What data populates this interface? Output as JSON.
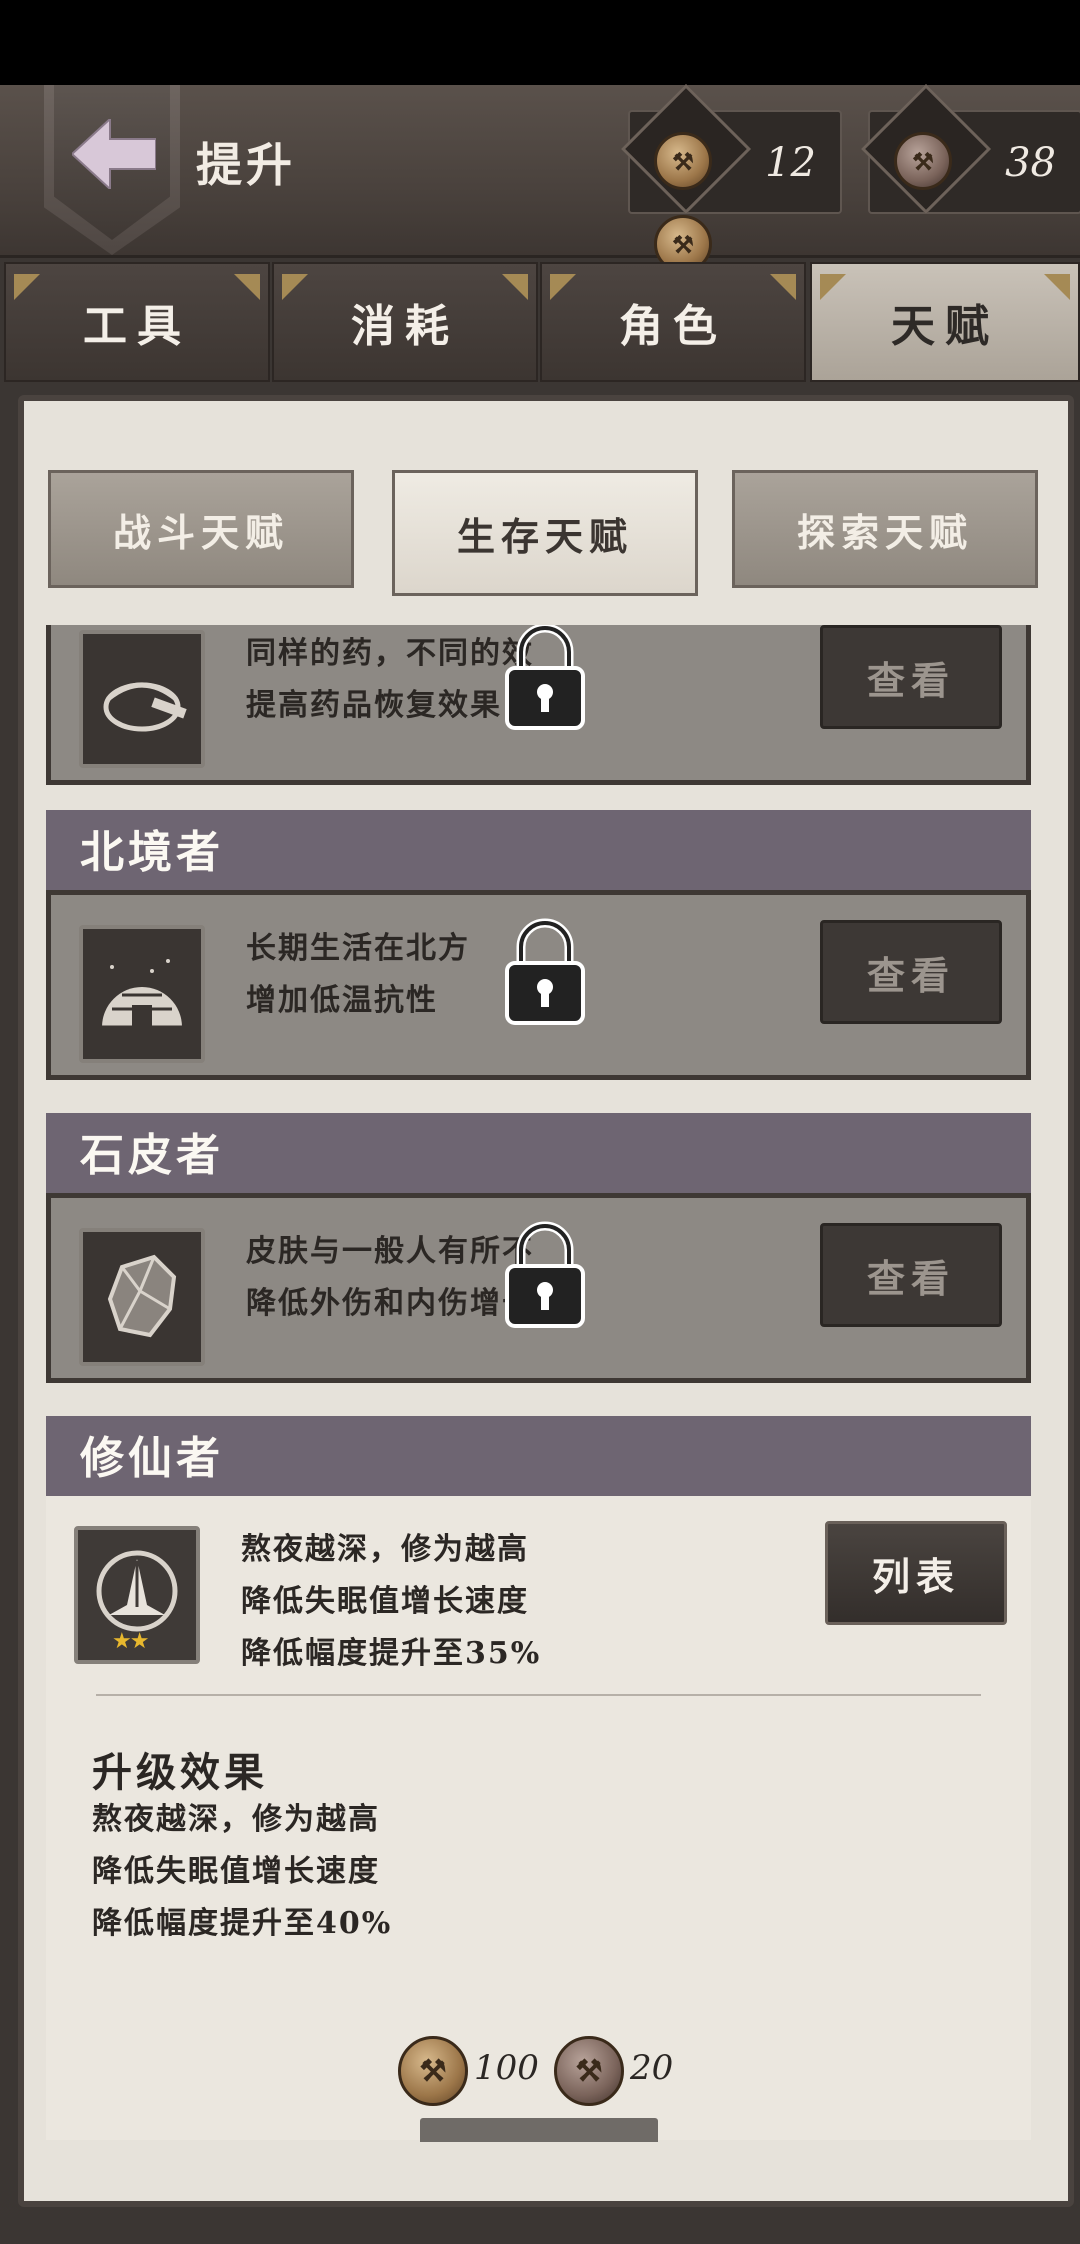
{
  "header": {
    "title": "提升",
    "currency": [
      {
        "icon": "axe-coin-icon",
        "value": "12"
      },
      {
        "icon": "axe-coin-dark-icon",
        "value": "38"
      }
    ]
  },
  "category_tabs": [
    {
      "label": "工具",
      "active": false
    },
    {
      "label": "消耗",
      "active": false
    },
    {
      "label": "角色",
      "active": false
    },
    {
      "label": "天赋",
      "active": true
    }
  ],
  "sub_tabs": [
    {
      "label": "战斗天赋",
      "active": false
    },
    {
      "label": "生存天赋",
      "active": true
    },
    {
      "label": "探索天赋",
      "active": false
    }
  ],
  "talents": [
    {
      "name": "",
      "icon": "medicine-bowl-icon",
      "desc": "同样的药，不同的效\n提高药品恢复效果",
      "locked": true,
      "button": "查看"
    },
    {
      "name": "北境者",
      "icon": "igloo-icon",
      "desc": "长期生活在北方\n增加低温抗性",
      "locked": true,
      "button": "查看"
    },
    {
      "name": "石皮者",
      "icon": "stone-skin-icon",
      "desc": "皮肤与一般人有所不\n降低外伤和内伤增长",
      "locked": true,
      "button": "查看"
    },
    {
      "name": "修仙者",
      "icon": "praying-hands-icon",
      "desc": "熬夜越深，修为越高\n降低失眠值增长速度\n降低幅度提升至35%",
      "locked": false,
      "stars": "★★",
      "button": "列表"
    }
  ],
  "upgrade": {
    "title": "升级效果",
    "lines": "熬夜越深，修为越高\n降低失眠值增长速度\n降低幅度提升至40%",
    "costs": [
      "100",
      "20"
    ]
  }
}
